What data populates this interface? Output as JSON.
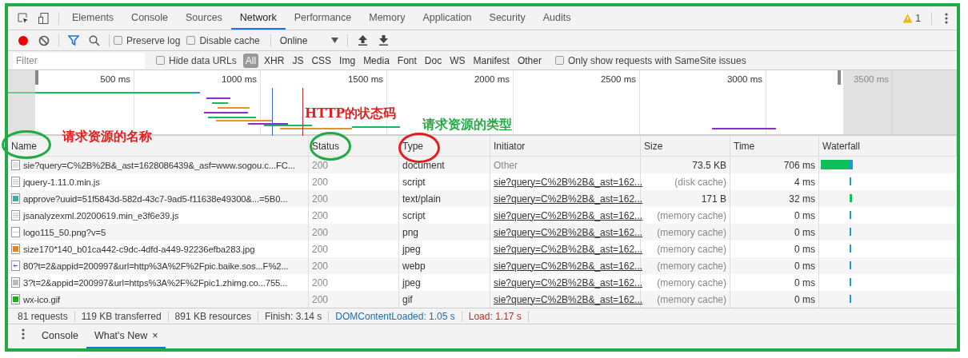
{
  "tabs": [
    {
      "label": "Elements",
      "selected": false
    },
    {
      "label": "Console",
      "selected": false
    },
    {
      "label": "Sources",
      "selected": false
    },
    {
      "label": "Network",
      "selected": true
    },
    {
      "label": "Performance",
      "selected": false
    },
    {
      "label": "Memory",
      "selected": false
    },
    {
      "label": "Application",
      "selected": false
    },
    {
      "label": "Security",
      "selected": false
    },
    {
      "label": "Audits",
      "selected": false
    }
  ],
  "warning_count": "1",
  "toolbar": {
    "recording": true,
    "preserve_log": {
      "label": "Preserve log",
      "checked": false
    },
    "disable_cache": {
      "label": "Disable cache",
      "checked": false
    },
    "throttling": "Online"
  },
  "filter_bar": {
    "placeholder": "Filter",
    "hide_data_urls": {
      "label": "Hide data URLs",
      "checked": false
    },
    "types": [
      {
        "label": "All",
        "selected": true
      },
      {
        "label": "XHR",
        "selected": false
      },
      {
        "label": "JS",
        "selected": false
      },
      {
        "label": "CSS",
        "selected": false
      },
      {
        "label": "Img",
        "selected": false
      },
      {
        "label": "Media",
        "selected": false
      },
      {
        "label": "Font",
        "selected": false
      },
      {
        "label": "Doc",
        "selected": false
      },
      {
        "label": "WS",
        "selected": false
      },
      {
        "label": "Manifest",
        "selected": false
      },
      {
        "label": "Other",
        "selected": false
      }
    ],
    "samesite": {
      "label": "Only show requests with SameSite issues",
      "checked": false
    }
  },
  "overview": {
    "ticks": [
      "500 ms",
      "1000 ms",
      "1500 ms",
      "2000 ms",
      "2500 ms",
      "3000 ms",
      "3500 ms"
    ]
  },
  "annotations": [
    {
      "kind": "name",
      "text": "请求资源的名称",
      "color": "#e02020"
    },
    {
      "kind": "status",
      "text": "HTTP的状态码",
      "color": "#e02020"
    },
    {
      "kind": "type",
      "text": "请求资源的类型",
      "color": "#22aa44"
    }
  ],
  "circles": [
    {
      "kind": "name",
      "color": "#22aa44"
    },
    {
      "kind": "status",
      "color": "#22aa44"
    },
    {
      "kind": "type",
      "color": "#e02020"
    }
  ],
  "table": {
    "columns": [
      "Name",
      "Status",
      "Type",
      "Initiator",
      "Size",
      "Time",
      "Waterfall"
    ],
    "rows": [
      {
        "kind": "document",
        "name": "sie?query=C%2B%2B&_ast=1628086439&_asf=www.sogou.c...FC...",
        "status": "200",
        "type": "document",
        "initiator": "Other",
        "initiator_link": false,
        "size": "73.5 KB",
        "size_cached": false,
        "time": "706 ms",
        "waterfall": {
          "kind": "long"
        }
      },
      {
        "kind": "document",
        "name": "jquery-1.11.0.min.js",
        "status": "200",
        "type": "script",
        "initiator": "sie?query=C%2B%2B&_ast=162...",
        "initiator_link": true,
        "size": "(disk cache)",
        "size_cached": true,
        "time": "4 ms",
        "waterfall": {
          "kind": "tick"
        }
      },
      {
        "kind": "image",
        "name": "approve?uuid=51f5843d-582d-43c7-9ad5-f11638e49300&...=5B0...",
        "status": "200",
        "type": "text/plain",
        "initiator": "sie?query=C%2B%2B&_ast=162...",
        "initiator_link": true,
        "size": "171 B",
        "size_cached": false,
        "time": "32 ms",
        "waterfall": {
          "kind": "short"
        }
      },
      {
        "kind": "document",
        "name": "jsanalyzexml.20200619.min_e3f6e39.js",
        "status": "200",
        "type": "script",
        "initiator": "sie?query=C%2B%2B&_ast=162...",
        "initiator_link": true,
        "size": "(memory cache)",
        "size_cached": true,
        "time": "0 ms",
        "waterfall": {
          "kind": "tick"
        }
      },
      {
        "kind": "blank",
        "name": "logo115_50.png?v=5",
        "status": "200",
        "type": "png",
        "initiator": "sie?query=C%2B%2B&_ast=162...",
        "initiator_link": true,
        "size": "(memory cache)",
        "size_cached": true,
        "time": "0 ms",
        "waterfall": {
          "kind": "tick"
        }
      },
      {
        "kind": "photo",
        "name": "size170*140_b01ca442-c9dc-4dfd-a449-92236efba283.jpg",
        "status": "200",
        "type": "jpeg",
        "initiator": "sie?query=C%2B%2B&_ast=162...",
        "initiator_link": true,
        "size": "(memory cache)",
        "size_cached": true,
        "time": "0 ms",
        "waterfall": {
          "kind": "tick"
        }
      },
      {
        "kind": "arrow",
        "name": "80?t=2&appid=200997&url=http%3A%2F%2Fpic.baike.sos...F%2...",
        "status": "200",
        "type": "webp",
        "initiator": "sie?query=C%2B%2B&_ast=162...",
        "initiator_link": true,
        "size": "(memory cache)",
        "size_cached": true,
        "time": "0 ms",
        "waterfall": {
          "kind": "tick"
        }
      },
      {
        "kind": "grey",
        "name": "3?t=2&appid=200997&url=https%3A%2F%2Fpic1.zhimg.co...755...",
        "status": "200",
        "type": "jpeg",
        "initiator": "sie?query=C%2B%2B&_ast=162...",
        "initiator_link": true,
        "size": "(memory cache)",
        "size_cached": true,
        "time": "0 ms",
        "waterfall": {
          "kind": "tick"
        }
      },
      {
        "kind": "green",
        "name": "wx-ico.gif",
        "status": "200",
        "type": "gif",
        "initiator": "sie?query=C%2B%2B&_ast=162...",
        "initiator_link": true,
        "size": "(memory cache)",
        "size_cached": true,
        "time": "0 ms",
        "waterfall": {
          "kind": "tick"
        }
      }
    ]
  },
  "summary": [
    {
      "kind": "plain",
      "text": "81 requests"
    },
    {
      "kind": "plain",
      "text": "119 KB transferred"
    },
    {
      "kind": "plain",
      "text": "891 KB resources"
    },
    {
      "kind": "plain",
      "text": "Finish: 3.14 s"
    },
    {
      "kind": "dom",
      "text": "DOMContentLoaded: 1.05 s"
    },
    {
      "kind": "load",
      "text": "Load: 1.17 s"
    }
  ],
  "drawer": {
    "tabs": [
      {
        "label": "Console",
        "selected": false,
        "closable": false
      },
      {
        "label": "What's New",
        "selected": true,
        "closable": true
      }
    ],
    "close_glyph": "×"
  }
}
